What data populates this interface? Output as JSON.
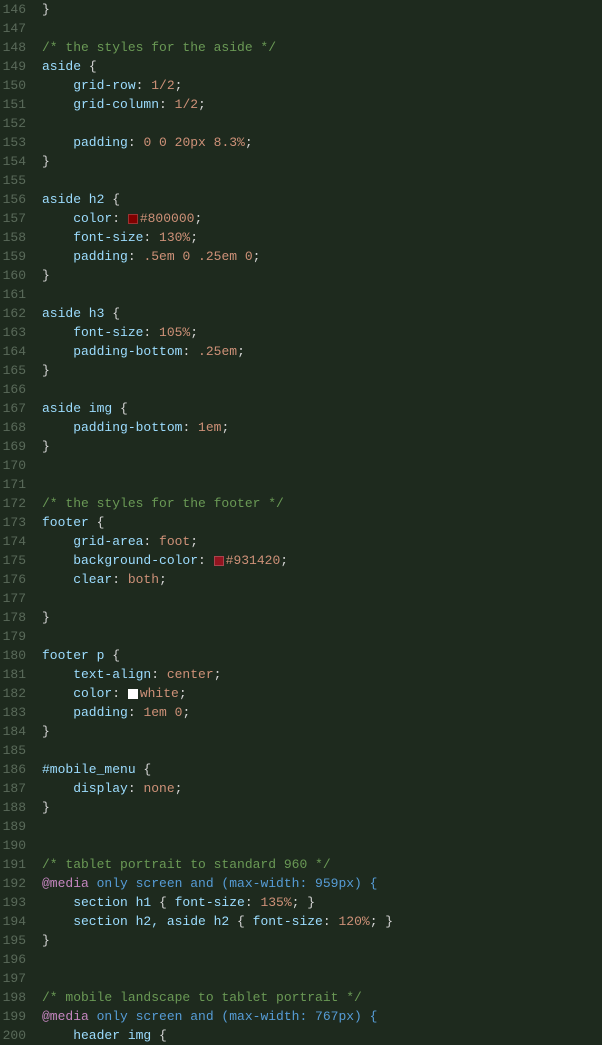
{
  "lines": [
    {
      "num": 146,
      "tokens": [
        {
          "t": "}",
          "c": "c-brace",
          "i": 1
        }
      ]
    },
    {
      "num": 147,
      "tokens": []
    },
    {
      "num": 148,
      "tokens": [
        {
          "t": "/* the styles for the aside */",
          "c": "c-comment"
        }
      ]
    },
    {
      "num": 149,
      "tokens": [
        {
          "t": "aside",
          "c": "c-selector"
        },
        {
          "t": " {",
          "c": "c-brace"
        }
      ]
    },
    {
      "num": 150,
      "tokens": [
        {
          "t": "    grid-row",
          "c": "c-property"
        },
        {
          "t": ": ",
          "c": "c-colon"
        },
        {
          "t": "1/2",
          "c": "c-value"
        },
        {
          "t": ";",
          "c": "c-punctuation"
        }
      ]
    },
    {
      "num": 151,
      "tokens": [
        {
          "t": "    grid-column",
          "c": "c-property"
        },
        {
          "t": ": ",
          "c": "c-colon"
        },
        {
          "t": "1/2",
          "c": "c-value"
        },
        {
          "t": ";",
          "c": "c-punctuation"
        }
      ]
    },
    {
      "num": 152,
      "tokens": []
    },
    {
      "num": 153,
      "tokens": [
        {
          "t": "    padding",
          "c": "c-property"
        },
        {
          "t": ": ",
          "c": "c-colon"
        },
        {
          "t": "0 0 20px 8.3%",
          "c": "c-value"
        },
        {
          "t": ";",
          "c": "c-punctuation"
        }
      ]
    },
    {
      "num": 154,
      "tokens": [
        {
          "t": "}",
          "c": "c-brace",
          "i": 1
        }
      ]
    },
    {
      "num": 155,
      "tokens": []
    },
    {
      "num": 156,
      "tokens": [
        {
          "t": "aside h2",
          "c": "c-selector"
        },
        {
          "t": " {",
          "c": "c-brace"
        }
      ]
    },
    {
      "num": 157,
      "tokens": [
        {
          "t": "    color",
          "c": "c-property"
        },
        {
          "t": ": ",
          "c": "c-colon"
        },
        {
          "t": "swatch:#800000",
          "c": "swatch"
        },
        {
          "t": "#800000",
          "c": "c-value"
        },
        {
          "t": ";",
          "c": "c-punctuation"
        }
      ]
    },
    {
      "num": 158,
      "tokens": [
        {
          "t": "    font-size",
          "c": "c-property"
        },
        {
          "t": ": ",
          "c": "c-colon"
        },
        {
          "t": "130%",
          "c": "c-value"
        },
        {
          "t": ";",
          "c": "c-punctuation"
        }
      ]
    },
    {
      "num": 159,
      "tokens": [
        {
          "t": "    padding",
          "c": "c-property"
        },
        {
          "t": ": ",
          "c": "c-colon"
        },
        {
          "t": ".5em 0 .25em 0",
          "c": "c-value"
        },
        {
          "t": ";",
          "c": "c-punctuation"
        }
      ]
    },
    {
      "num": 160,
      "tokens": [
        {
          "t": "}",
          "c": "c-brace",
          "i": 1
        }
      ]
    },
    {
      "num": 161,
      "tokens": []
    },
    {
      "num": 162,
      "tokens": [
        {
          "t": "aside h3",
          "c": "c-selector"
        },
        {
          "t": " {",
          "c": "c-brace"
        }
      ]
    },
    {
      "num": 163,
      "tokens": [
        {
          "t": "    font-size",
          "c": "c-property"
        },
        {
          "t": ": ",
          "c": "c-colon"
        },
        {
          "t": "105%",
          "c": "c-value"
        },
        {
          "t": ";",
          "c": "c-punctuation"
        }
      ]
    },
    {
      "num": 164,
      "tokens": [
        {
          "t": "    padding-bottom",
          "c": "c-property"
        },
        {
          "t": ": ",
          "c": "c-colon"
        },
        {
          "t": ".25em",
          "c": "c-value"
        },
        {
          "t": ";",
          "c": "c-punctuation"
        }
      ]
    },
    {
      "num": 165,
      "tokens": [
        {
          "t": "}",
          "c": "c-brace",
          "i": 1
        }
      ]
    },
    {
      "num": 166,
      "tokens": []
    },
    {
      "num": 167,
      "tokens": [
        {
          "t": "aside img",
          "c": "c-selector"
        },
        {
          "t": " {",
          "c": "c-brace"
        }
      ]
    },
    {
      "num": 168,
      "tokens": [
        {
          "t": "    padding-bottom",
          "c": "c-property"
        },
        {
          "t": ": ",
          "c": "c-colon"
        },
        {
          "t": "1em",
          "c": "c-value"
        },
        {
          "t": ";",
          "c": "c-punctuation"
        }
      ]
    },
    {
      "num": 169,
      "tokens": [
        {
          "t": "}",
          "c": "c-brace",
          "i": 1
        }
      ]
    },
    {
      "num": 170,
      "tokens": []
    },
    {
      "num": 171,
      "tokens": []
    },
    {
      "num": 172,
      "tokens": [
        {
          "t": "/* the styles for the footer */",
          "c": "c-comment"
        }
      ]
    },
    {
      "num": 173,
      "tokens": [
        {
          "t": "footer",
          "c": "c-selector"
        },
        {
          "t": " {",
          "c": "c-brace"
        }
      ]
    },
    {
      "num": 174,
      "tokens": [
        {
          "t": "    grid-area",
          "c": "c-property"
        },
        {
          "t": ": ",
          "c": "c-colon"
        },
        {
          "t": "foot",
          "c": "c-value"
        },
        {
          "t": ";",
          "c": "c-punctuation"
        }
      ]
    },
    {
      "num": 175,
      "tokens": [
        {
          "t": "    background-color",
          "c": "c-property"
        },
        {
          "t": ": ",
          "c": "c-colon"
        },
        {
          "t": "swatch:#931420",
          "c": "swatch"
        },
        {
          "t": "#931420",
          "c": "c-value"
        },
        {
          "t": ";",
          "c": "c-punctuation"
        }
      ]
    },
    {
      "num": 176,
      "tokens": [
        {
          "t": "    clear",
          "c": "c-property"
        },
        {
          "t": ": ",
          "c": "c-colon"
        },
        {
          "t": "both",
          "c": "c-value"
        },
        {
          "t": ";",
          "c": "c-punctuation"
        }
      ]
    },
    {
      "num": 177,
      "tokens": []
    },
    {
      "num": 178,
      "tokens": [
        {
          "t": "}",
          "c": "c-brace",
          "i": 1
        }
      ]
    },
    {
      "num": 179,
      "tokens": []
    },
    {
      "num": 180,
      "tokens": [
        {
          "t": "footer p",
          "c": "c-selector"
        },
        {
          "t": " {",
          "c": "c-brace"
        }
      ]
    },
    {
      "num": 181,
      "tokens": [
        {
          "t": "    text-align",
          "c": "c-property"
        },
        {
          "t": ": ",
          "c": "c-colon"
        },
        {
          "t": "center",
          "c": "c-value"
        },
        {
          "t": ";",
          "c": "c-punctuation"
        }
      ]
    },
    {
      "num": 182,
      "tokens": [
        {
          "t": "    color",
          "c": "c-property"
        },
        {
          "t": ": ",
          "c": "c-colon"
        },
        {
          "t": "swatch:#ffffff",
          "c": "swatch"
        },
        {
          "t": "white",
          "c": "c-value"
        },
        {
          "t": ";",
          "c": "c-punctuation"
        }
      ]
    },
    {
      "num": 183,
      "tokens": [
        {
          "t": "    padding",
          "c": "c-property"
        },
        {
          "t": ": ",
          "c": "c-colon"
        },
        {
          "t": "1em 0",
          "c": "c-value"
        },
        {
          "t": ";",
          "c": "c-punctuation"
        }
      ]
    },
    {
      "num": 184,
      "tokens": [
        {
          "t": "}",
          "c": "c-brace",
          "i": 1
        }
      ]
    },
    {
      "num": 185,
      "tokens": []
    },
    {
      "num": 186,
      "tokens": [
        {
          "t": "#mobile_menu",
          "c": "c-selector"
        },
        {
          "t": " {",
          "c": "c-brace"
        }
      ]
    },
    {
      "num": 187,
      "tokens": [
        {
          "t": "    display",
          "c": "c-property"
        },
        {
          "t": ": ",
          "c": "c-colon"
        },
        {
          "t": "none",
          "c": "c-value"
        },
        {
          "t": ";",
          "c": "c-punctuation"
        }
      ]
    },
    {
      "num": 188,
      "tokens": [
        {
          "t": "}",
          "c": "c-brace",
          "i": 1
        }
      ]
    },
    {
      "num": 189,
      "tokens": []
    },
    {
      "num": 190,
      "tokens": []
    },
    {
      "num": 191,
      "tokens": [
        {
          "t": "/* tablet portrait to standard 960 */",
          "c": "c-comment"
        }
      ]
    },
    {
      "num": 192,
      "tokens": [
        {
          "t": "@media",
          "c": "c-at"
        },
        {
          "t": " only screen and (max-width: 959px) {",
          "c": "c-mediakw"
        }
      ]
    },
    {
      "num": 193,
      "tokens": [
        {
          "t": "    section h1",
          "c": "c-selector"
        },
        {
          "t": " { ",
          "c": "c-brace"
        },
        {
          "t": "font-size",
          "c": "c-property"
        },
        {
          "t": ": ",
          "c": "c-colon"
        },
        {
          "t": "135%",
          "c": "c-value"
        },
        {
          "t": "; }",
          "c": "c-punctuation"
        }
      ]
    },
    {
      "num": 194,
      "tokens": [
        {
          "t": "    section h2, aside h2",
          "c": "c-selector"
        },
        {
          "t": " { ",
          "c": "c-brace"
        },
        {
          "t": "font-size",
          "c": "c-property"
        },
        {
          "t": ": ",
          "c": "c-colon"
        },
        {
          "t": "120%",
          "c": "c-value"
        },
        {
          "t": "; }",
          "c": "c-punctuation"
        }
      ]
    },
    {
      "num": 195,
      "tokens": [
        {
          "t": "}",
          "c": "c-brace",
          "i": 1
        }
      ]
    },
    {
      "num": 196,
      "tokens": []
    },
    {
      "num": 197,
      "tokens": []
    },
    {
      "num": 198,
      "tokens": [
        {
          "t": "/* mobile landscape to tablet portrait */",
          "c": "c-comment"
        }
      ]
    },
    {
      "num": 199,
      "tokens": [
        {
          "t": "@media",
          "c": "c-at"
        },
        {
          "t": " only screen and (max-width: 767px) {",
          "c": "c-mediakw"
        }
      ]
    },
    {
      "num": 200,
      "tokens": [
        {
          "t": "    header img",
          "c": "c-selector"
        },
        {
          "t": " {",
          "c": "c-brace"
        }
      ]
    }
  ],
  "colors": {
    "background": "#1e2a1e",
    "linenum": "#5a6a5a"
  }
}
